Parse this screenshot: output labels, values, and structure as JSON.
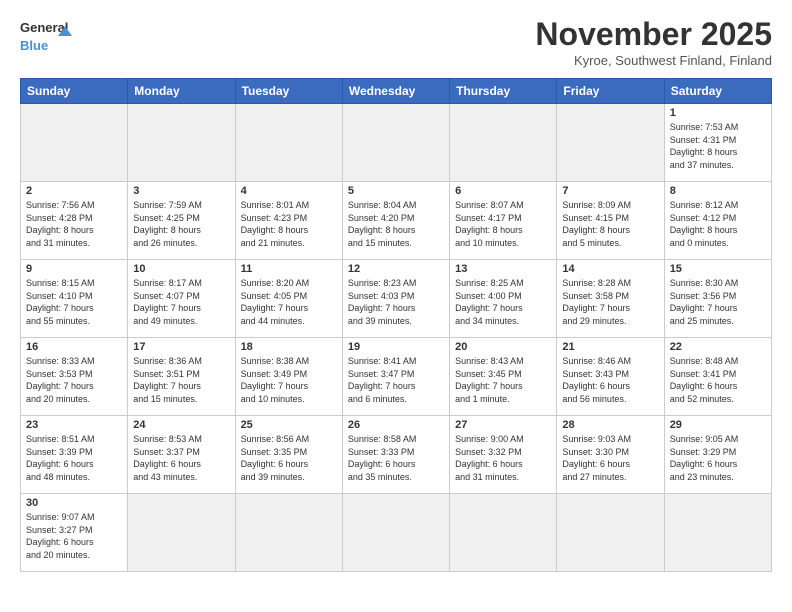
{
  "header": {
    "logo_general": "General",
    "logo_blue": "Blue",
    "month_title": "November 2025",
    "location": "Kyroe, Southwest Finland, Finland"
  },
  "weekdays": [
    "Sunday",
    "Monday",
    "Tuesday",
    "Wednesday",
    "Thursday",
    "Friday",
    "Saturday"
  ],
  "days": [
    {
      "date": "",
      "info": ""
    },
    {
      "date": "",
      "info": ""
    },
    {
      "date": "",
      "info": ""
    },
    {
      "date": "",
      "info": ""
    },
    {
      "date": "",
      "info": ""
    },
    {
      "date": "",
      "info": ""
    },
    {
      "date": "1",
      "info": "Sunrise: 7:53 AM\nSunset: 4:31 PM\nDaylight: 8 hours\nand 37 minutes."
    },
    {
      "date": "2",
      "info": "Sunrise: 7:56 AM\nSunset: 4:28 PM\nDaylight: 8 hours\nand 31 minutes."
    },
    {
      "date": "3",
      "info": "Sunrise: 7:59 AM\nSunset: 4:25 PM\nDaylight: 8 hours\nand 26 minutes."
    },
    {
      "date": "4",
      "info": "Sunrise: 8:01 AM\nSunset: 4:23 PM\nDaylight: 8 hours\nand 21 minutes."
    },
    {
      "date": "5",
      "info": "Sunrise: 8:04 AM\nSunset: 4:20 PM\nDaylight: 8 hours\nand 15 minutes."
    },
    {
      "date": "6",
      "info": "Sunrise: 8:07 AM\nSunset: 4:17 PM\nDaylight: 8 hours\nand 10 minutes."
    },
    {
      "date": "7",
      "info": "Sunrise: 8:09 AM\nSunset: 4:15 PM\nDaylight: 8 hours\nand 5 minutes."
    },
    {
      "date": "8",
      "info": "Sunrise: 8:12 AM\nSunset: 4:12 PM\nDaylight: 8 hours\nand 0 minutes."
    },
    {
      "date": "9",
      "info": "Sunrise: 8:15 AM\nSunset: 4:10 PM\nDaylight: 7 hours\nand 55 minutes."
    },
    {
      "date": "10",
      "info": "Sunrise: 8:17 AM\nSunset: 4:07 PM\nDaylight: 7 hours\nand 49 minutes."
    },
    {
      "date": "11",
      "info": "Sunrise: 8:20 AM\nSunset: 4:05 PM\nDaylight: 7 hours\nand 44 minutes."
    },
    {
      "date": "12",
      "info": "Sunrise: 8:23 AM\nSunset: 4:03 PM\nDaylight: 7 hours\nand 39 minutes."
    },
    {
      "date": "13",
      "info": "Sunrise: 8:25 AM\nSunset: 4:00 PM\nDaylight: 7 hours\nand 34 minutes."
    },
    {
      "date": "14",
      "info": "Sunrise: 8:28 AM\nSunset: 3:58 PM\nDaylight: 7 hours\nand 29 minutes."
    },
    {
      "date": "15",
      "info": "Sunrise: 8:30 AM\nSunset: 3:56 PM\nDaylight: 7 hours\nand 25 minutes."
    },
    {
      "date": "16",
      "info": "Sunrise: 8:33 AM\nSunset: 3:53 PM\nDaylight: 7 hours\nand 20 minutes."
    },
    {
      "date": "17",
      "info": "Sunrise: 8:36 AM\nSunset: 3:51 PM\nDaylight: 7 hours\nand 15 minutes."
    },
    {
      "date": "18",
      "info": "Sunrise: 8:38 AM\nSunset: 3:49 PM\nDaylight: 7 hours\nand 10 minutes."
    },
    {
      "date": "19",
      "info": "Sunrise: 8:41 AM\nSunset: 3:47 PM\nDaylight: 7 hours\nand 6 minutes."
    },
    {
      "date": "20",
      "info": "Sunrise: 8:43 AM\nSunset: 3:45 PM\nDaylight: 7 hours\nand 1 minute."
    },
    {
      "date": "21",
      "info": "Sunrise: 8:46 AM\nSunset: 3:43 PM\nDaylight: 6 hours\nand 56 minutes."
    },
    {
      "date": "22",
      "info": "Sunrise: 8:48 AM\nSunset: 3:41 PM\nDaylight: 6 hours\nand 52 minutes."
    },
    {
      "date": "23",
      "info": "Sunrise: 8:51 AM\nSunset: 3:39 PM\nDaylight: 6 hours\nand 48 minutes."
    },
    {
      "date": "24",
      "info": "Sunrise: 8:53 AM\nSunset: 3:37 PM\nDaylight: 6 hours\nand 43 minutes."
    },
    {
      "date": "25",
      "info": "Sunrise: 8:56 AM\nSunset: 3:35 PM\nDaylight: 6 hours\nand 39 minutes."
    },
    {
      "date": "26",
      "info": "Sunrise: 8:58 AM\nSunset: 3:33 PM\nDaylight: 6 hours\nand 35 minutes."
    },
    {
      "date": "27",
      "info": "Sunrise: 9:00 AM\nSunset: 3:32 PM\nDaylight: 6 hours\nand 31 minutes."
    },
    {
      "date": "28",
      "info": "Sunrise: 9:03 AM\nSunset: 3:30 PM\nDaylight: 6 hours\nand 27 minutes."
    },
    {
      "date": "29",
      "info": "Sunrise: 9:05 AM\nSunset: 3:29 PM\nDaylight: 6 hours\nand 23 minutes."
    },
    {
      "date": "30",
      "info": "Sunrise: 9:07 AM\nSunset: 3:27 PM\nDaylight: 6 hours\nand 20 minutes."
    }
  ]
}
